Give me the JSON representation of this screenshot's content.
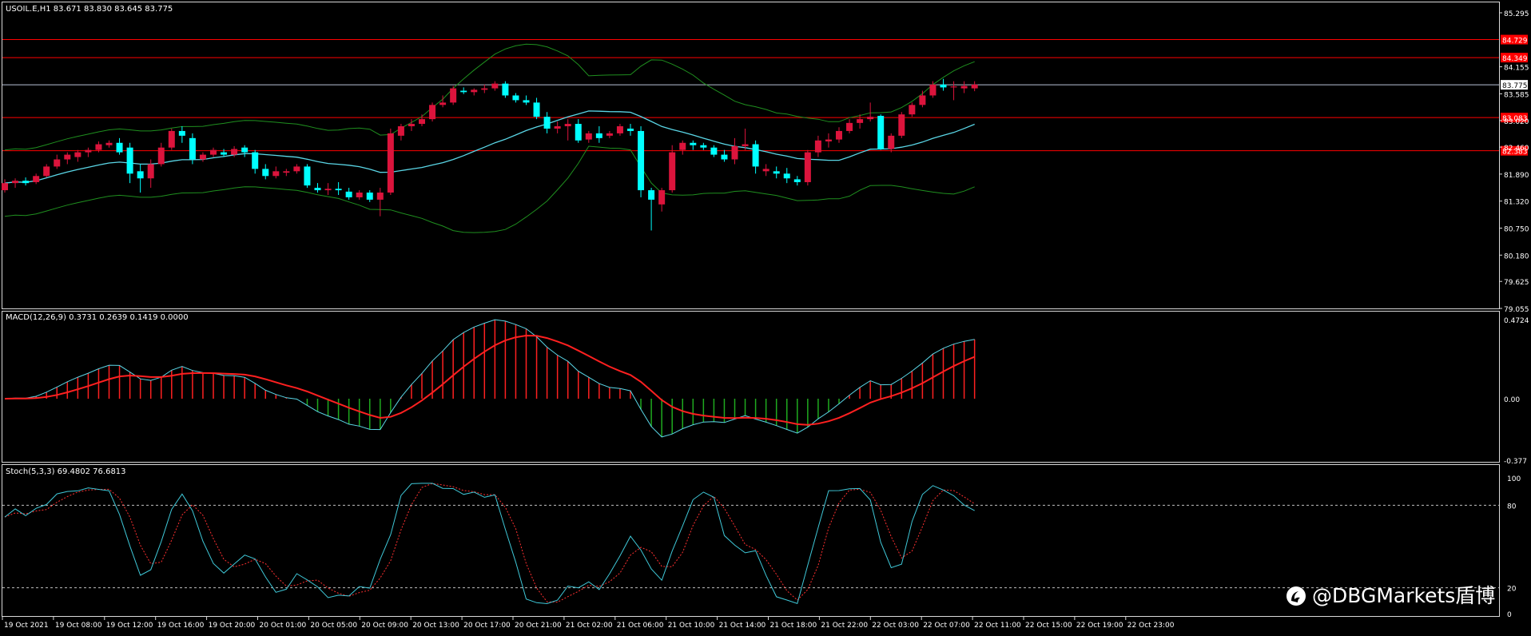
{
  "colors": {
    "background": "#000000",
    "frame": "#d9d9d9",
    "bull": "#dc143c",
    "bear": "#00ffff",
    "bands": "#1f8f1f",
    "ma": "#5ad6e6",
    "level_lines": "#ff0000",
    "price_line": "#b9c3d6",
    "label_text": "#ffffff",
    "macd_line": "#5ad6e6",
    "signal_line": "#ff2020",
    "hist_pos": "#ff2020",
    "hist_neg": "#1faa1f",
    "stoch_main": "#3fc8d8",
    "stoch_signal": "#ff3030",
    "stoch_levels": "#c0c0c0"
  },
  "main": {
    "header": "USOIL.E,H1  83.671 83.830 83.645 83.775",
    "price_axis": [
      "85.295",
      "84.155",
      "83.585",
      "83.020",
      "82.460",
      "81.890",
      "81.320",
      "80.750",
      "80.180",
      "79.625",
      "79.055"
    ],
    "current_price": "83.775",
    "levels": [
      "84.729",
      "84.349",
      "83.083",
      "82.383"
    ]
  },
  "macd": {
    "header": "MACD(12,26,9) 0.3731 0.2639 0.1419 0.0000",
    "axis": [
      "0.4724",
      "0.00",
      "-0.377"
    ]
  },
  "stoch": {
    "header": "Stoch(5,3,3) 69.4802 76.6813",
    "axis": [
      "100",
      "80",
      "20",
      "0"
    ]
  },
  "time_axis": [
    "19 Oct 2021",
    "19 Oct 08:00",
    "19 Oct 12:00",
    "19 Oct 16:00",
    "19 Oct 20:00",
    "20 Oct 01:00",
    "20 Oct 05:00",
    "20 Oct 09:00",
    "20 Oct 13:00",
    "20 Oct 17:00",
    "20 Oct 21:00",
    "21 Oct 02:00",
    "21 Oct 06:00",
    "21 Oct 10:00",
    "21 Oct 14:00",
    "21 Oct 18:00",
    "21 Oct 22:00",
    "22 Oct 03:00",
    "22 Oct 07:00",
    "22 Oct 11:00",
    "22 Oct 15:00",
    "22 Oct 19:00",
    "22 Oct 23:00"
  ],
  "watermark": {
    "text": "@DBGMarkets盾博",
    "icon": "weibo-logo-icon"
  },
  "chart_data": {
    "type": "candlestick",
    "symbol": "USOIL.E",
    "timeframe": "H1",
    "ylim": [
      79.055,
      85.295
    ],
    "candles": [
      [
        81.55,
        81.78,
        81.5,
        81.7
      ],
      [
        81.7,
        81.8,
        81.6,
        81.75
      ],
      [
        81.75,
        81.82,
        81.65,
        81.7
      ],
      [
        81.72,
        81.9,
        81.68,
        81.85
      ],
      [
        81.85,
        82.1,
        81.82,
        82.05
      ],
      [
        82.05,
        82.3,
        82.0,
        82.2
      ],
      [
        82.2,
        82.35,
        82.1,
        82.3
      ],
      [
        82.25,
        82.4,
        82.15,
        82.35
      ],
      [
        82.35,
        82.45,
        82.25,
        82.4
      ],
      [
        82.4,
        82.58,
        82.35,
        82.52
      ],
      [
        82.5,
        82.6,
        82.45,
        82.55
      ],
      [
        82.55,
        82.65,
        82.3,
        82.35
      ],
      [
        82.45,
        82.55,
        81.7,
        81.9
      ],
      [
        81.95,
        82.1,
        81.5,
        81.8
      ],
      [
        81.8,
        82.2,
        81.6,
        82.1
      ],
      [
        82.1,
        82.55,
        82.05,
        82.45
      ],
      [
        82.45,
        82.85,
        82.4,
        82.8
      ],
      [
        82.8,
        82.9,
        82.55,
        82.7
      ],
      [
        82.65,
        82.75,
        82.1,
        82.2
      ],
      [
        82.2,
        82.35,
        82.15,
        82.3
      ],
      [
        82.3,
        82.45,
        82.25,
        82.4
      ],
      [
        82.35,
        82.42,
        82.25,
        82.3
      ],
      [
        82.3,
        82.48,
        82.25,
        82.42
      ],
      [
        82.45,
        82.5,
        82.25,
        82.35
      ],
      [
        82.35,
        82.4,
        81.9,
        82.0
      ],
      [
        82.0,
        82.1,
        81.78,
        81.85
      ],
      [
        81.85,
        82.05,
        81.8,
        81.95
      ],
      [
        81.92,
        82.0,
        81.85,
        81.95
      ],
      [
        81.95,
        82.1,
        81.9,
        82.05
      ],
      [
        82.05,
        82.1,
        81.6,
        81.65
      ],
      [
        81.6,
        81.7,
        81.5,
        81.55
      ],
      [
        81.55,
        81.7,
        81.45,
        81.58
      ],
      [
        81.58,
        81.72,
        81.45,
        81.55
      ],
      [
        81.52,
        81.6,
        81.35,
        81.4
      ],
      [
        81.4,
        81.55,
        81.35,
        81.5
      ],
      [
        81.5,
        81.55,
        81.3,
        81.35
      ],
      [
        81.35,
        81.6,
        81.0,
        81.5
      ],
      [
        81.5,
        82.85,
        81.45,
        82.75
      ],
      [
        82.7,
        82.95,
        82.6,
        82.9
      ],
      [
        82.9,
        83.05,
        82.8,
        82.95
      ],
      [
        82.95,
        83.15,
        82.9,
        83.05
      ],
      [
        83.05,
        83.4,
        83.0,
        83.35
      ],
      [
        83.35,
        83.55,
        83.3,
        83.4
      ],
      [
        83.4,
        83.75,
        83.35,
        83.7
      ],
      [
        83.65,
        83.72,
        83.58,
        83.62
      ],
      [
        83.62,
        83.7,
        83.55,
        83.67
      ],
      [
        83.67,
        83.78,
        83.6,
        83.7
      ],
      [
        83.7,
        83.85,
        83.65,
        83.8
      ],
      [
        83.8,
        83.85,
        83.5,
        83.55
      ],
      [
        83.55,
        83.6,
        83.4,
        83.45
      ],
      [
        83.45,
        83.55,
        83.35,
        83.4
      ],
      [
        83.4,
        83.5,
        83.05,
        83.1
      ],
      [
        83.1,
        83.2,
        82.75,
        82.85
      ],
      [
        82.85,
        83.0,
        82.75,
        82.9
      ],
      [
        82.9,
        83.05,
        82.6,
        82.95
      ],
      [
        82.95,
        83.05,
        82.55,
        82.6
      ],
      [
        82.62,
        82.8,
        82.55,
        82.75
      ],
      [
        82.75,
        82.9,
        82.55,
        82.65
      ],
      [
        82.7,
        82.8,
        82.65,
        82.75
      ],
      [
        82.75,
        82.95,
        82.7,
        82.9
      ],
      [
        82.85,
        82.95,
        82.7,
        82.8
      ],
      [
        82.8,
        82.9,
        81.4,
        81.55
      ],
      [
        81.55,
        81.6,
        80.7,
        81.35
      ],
      [
        81.25,
        81.6,
        81.1,
        81.55
      ],
      [
        81.55,
        82.5,
        81.5,
        82.35
      ],
      [
        82.4,
        82.6,
        82.3,
        82.55
      ],
      [
        82.55,
        82.6,
        82.4,
        82.5
      ],
      [
        82.5,
        82.55,
        82.4,
        82.45
      ],
      [
        82.45,
        82.5,
        82.25,
        82.3
      ],
      [
        82.3,
        82.4,
        82.15,
        82.2
      ],
      [
        82.2,
        82.65,
        82.1,
        82.48
      ],
      [
        82.48,
        82.85,
        82.4,
        82.52
      ],
      [
        82.52,
        82.6,
        81.9,
        82.05
      ],
      [
        81.95,
        82.1,
        81.85,
        82.0
      ],
      [
        81.95,
        82.05,
        81.8,
        81.9
      ],
      [
        81.9,
        82.02,
        81.7,
        81.8
      ],
      [
        81.78,
        81.85,
        81.65,
        81.72
      ],
      [
        81.72,
        82.4,
        81.65,
        82.35
      ],
      [
        82.35,
        82.7,
        82.25,
        82.6
      ],
      [
        82.58,
        82.75,
        82.45,
        82.62
      ],
      [
        82.62,
        82.88,
        82.55,
        82.8
      ],
      [
        82.8,
        83.05,
        82.75,
        82.97
      ],
      [
        82.97,
        83.15,
        82.85,
        83.05
      ],
      [
        83.05,
        83.4,
        83.0,
        83.1
      ],
      [
        83.12,
        83.15,
        82.4,
        82.42
      ],
      [
        82.42,
        82.75,
        82.35,
        82.7
      ],
      [
        82.7,
        83.2,
        82.65,
        83.15
      ],
      [
        83.15,
        83.4,
        83.1,
        83.35
      ],
      [
        83.35,
        83.65,
        83.3,
        83.55
      ],
      [
        83.55,
        83.85,
        83.5,
        83.78
      ],
      [
        83.78,
        83.9,
        83.65,
        83.72
      ],
      [
        83.72,
        83.85,
        83.45,
        83.74
      ],
      [
        83.7,
        83.85,
        83.6,
        83.75
      ],
      [
        83.7,
        83.85,
        83.64,
        83.78
      ]
    ],
    "indicators": [
      {
        "name": "MACD(12,26,9)",
        "values": [
          0.3731,
          0.2639,
          0.1419,
          0.0
        ],
        "ylim": [
          -0.377,
          0.4724
        ]
      },
      {
        "name": "Stoch(5,3,3)",
        "values": [
          69.4802,
          76.6813
        ],
        "ylim": [
          0,
          100
        ],
        "levels": [
          80,
          20
        ]
      }
    ],
    "grid": false
  }
}
